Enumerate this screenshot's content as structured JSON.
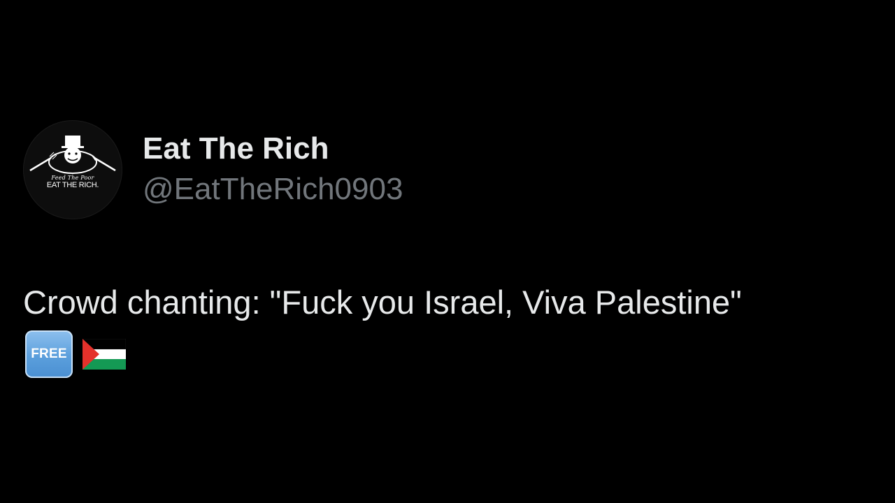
{
  "profile": {
    "display_name": "Eat The Rich",
    "handle": "@EatTheRich0903",
    "avatar": {
      "logo_script_text": "Feed The Poor",
      "logo_main_text": "EAT THE RICH."
    }
  },
  "tweet": {
    "text": "Crowd chanting: \"Fuck you Israel, Viva Palestine\"",
    "emojis": [
      {
        "name": "free-button-emoji",
        "label": "FREE"
      },
      {
        "name": "palestine-flag-emoji"
      }
    ]
  },
  "colors": {
    "background": "#000000",
    "primary_text": "#e7e9ea",
    "secondary_text": "#71767b",
    "flag_black": "#000000",
    "flag_white": "#ffffff",
    "flag_green": "#149954",
    "flag_red": "#e4312b"
  }
}
